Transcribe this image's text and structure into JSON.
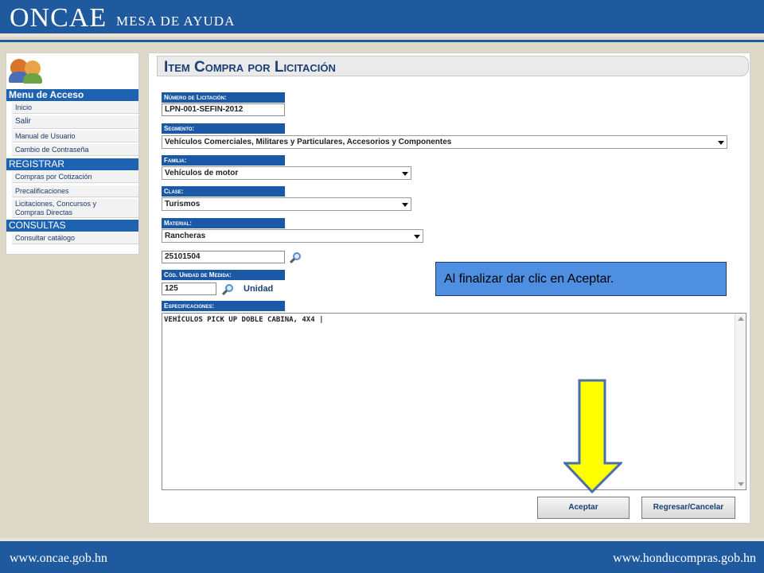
{
  "header": {
    "logo": "ONCAE",
    "subtitle": "MESA DE AYUDA"
  },
  "footer": {
    "left_url": "www.oncae.gob.hn",
    "right_url": "www.honducompras.gob.hn"
  },
  "sidebar": {
    "access_header": "Menu de Acceso",
    "inicio": "Inicio",
    "salir": "Salir",
    "manual": "Manual de Usuario",
    "cambio": "Cambio de Contraseña",
    "registrar_header": "REGISTRAR",
    "compras_cotizacion": "Compras por Cotización",
    "precalificaciones": "Precalificaciones",
    "licitaciones_l1": "Licitaciones, Concursos y",
    "licitaciones_l2": "Compras Directas",
    "consultas_header": "CONSULTAS",
    "consultar_catalogo": "Consultar catálogo"
  },
  "form": {
    "title": "Item Compra por Licitación",
    "numero_label": "Número de Licitación:",
    "numero_value": "LPN-001-SEFIN-2012",
    "segmento_label": "Segmento:",
    "segmento_value": "Vehículos Comerciales, Militares y Particulares, Accesorios y Componentes",
    "familia_label": "Familia:",
    "familia_value": "Vehículos de motor",
    "clase_label": "Clase:",
    "clase_value": "Turismos",
    "material_label": "Material:",
    "material_value": "Rancheras",
    "material_code": "25101504",
    "unidad_label": "Cód. Unidad de Medida:",
    "unidad_code": "125",
    "unidad_name": "Unidad",
    "especificaciones_label": "Especificaciones:",
    "especificaciones_value": "VEHÍCULOS PICK UP DOBLE CABINA, 4X4 |",
    "aceptar": "Aceptar",
    "regresar": "Regresar/Cancelar"
  },
  "callout": {
    "text": "Al finalizar dar clic en Aceptar."
  },
  "colors": {
    "banner": "#1f5a9e",
    "label_bg": "#1b58a6",
    "callout_bg": "#4f8fe2",
    "arrow": "#ffff00"
  }
}
